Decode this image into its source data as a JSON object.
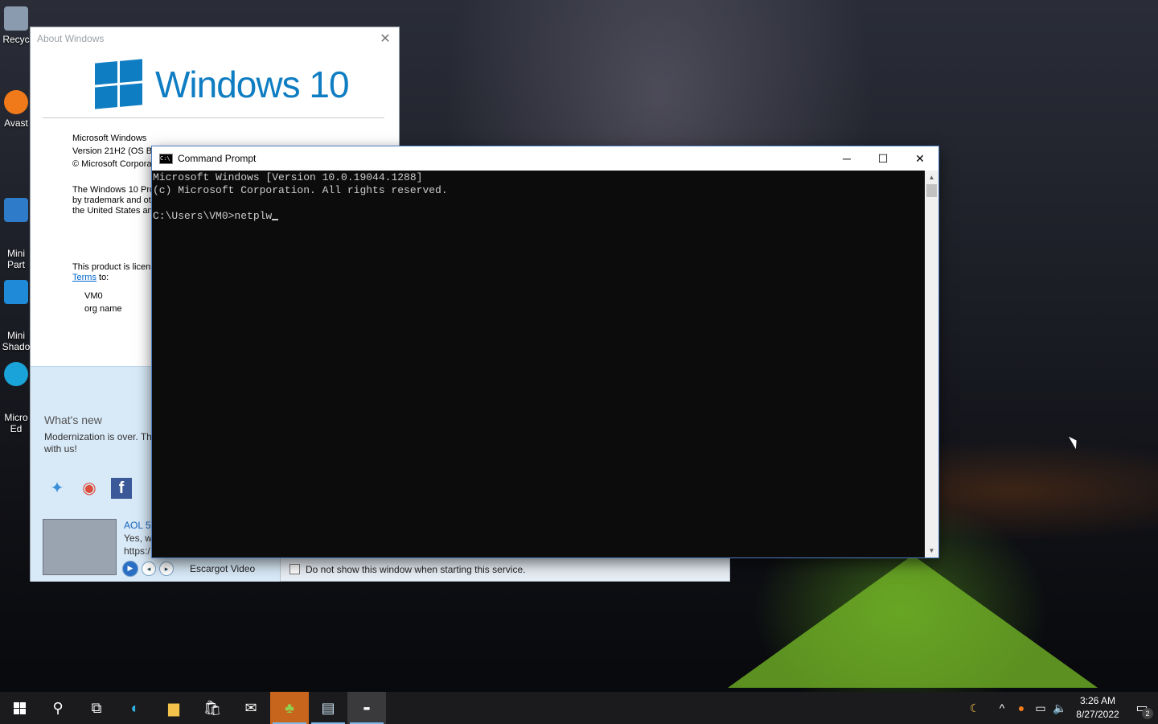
{
  "desktop": {
    "icons": [
      {
        "label": "Recyc",
        "color": "#8a9bb0"
      },
      {
        "label": "Avast",
        "color": "#f07a1a"
      },
      {
        "label": "Mini\nPart",
        "color": "#2e7cc9"
      },
      {
        "label": "Mini\nShado",
        "color": "#1f8ad8"
      },
      {
        "label": "Micro\nEd",
        "color": "#1aa3d8"
      }
    ]
  },
  "about": {
    "title": "About Windows",
    "brand": "Windows 10",
    "line1": "Microsoft Windows",
    "line2": "Version 21H2 (OS Bu",
    "line3": "© Microsoft Corpora",
    "para1_l1": "The Windows 10 Pro",
    "para1_l2": "by trademark and ot",
    "para1_l3": "the United States an",
    "lic_l1": "This product is licens",
    "lic_terms": "Terms",
    "lic_to": " to:",
    "user": "VM0",
    "org": "org name",
    "whatsnew": "What's new",
    "newstext": "Modernization is over. Th with us!",
    "aol_title": "AOL 5.",
    "yes_l1": "Yes, we",
    "yes_l2": "https:/",
    "media_label": "Escargot Video",
    "dontshow": "Do not show this window when starting this service."
  },
  "cmd": {
    "title": "Command Prompt",
    "line1": "Microsoft Windows [Version 10.0.19044.1288]",
    "line2": "(c) Microsoft Corporation. All rights reserved.",
    "prompt": "C:\\Users\\VM0>netplw"
  },
  "taskbar": {
    "time": "3:26 AM",
    "date": "8/27/2022",
    "notif_count": "2"
  }
}
